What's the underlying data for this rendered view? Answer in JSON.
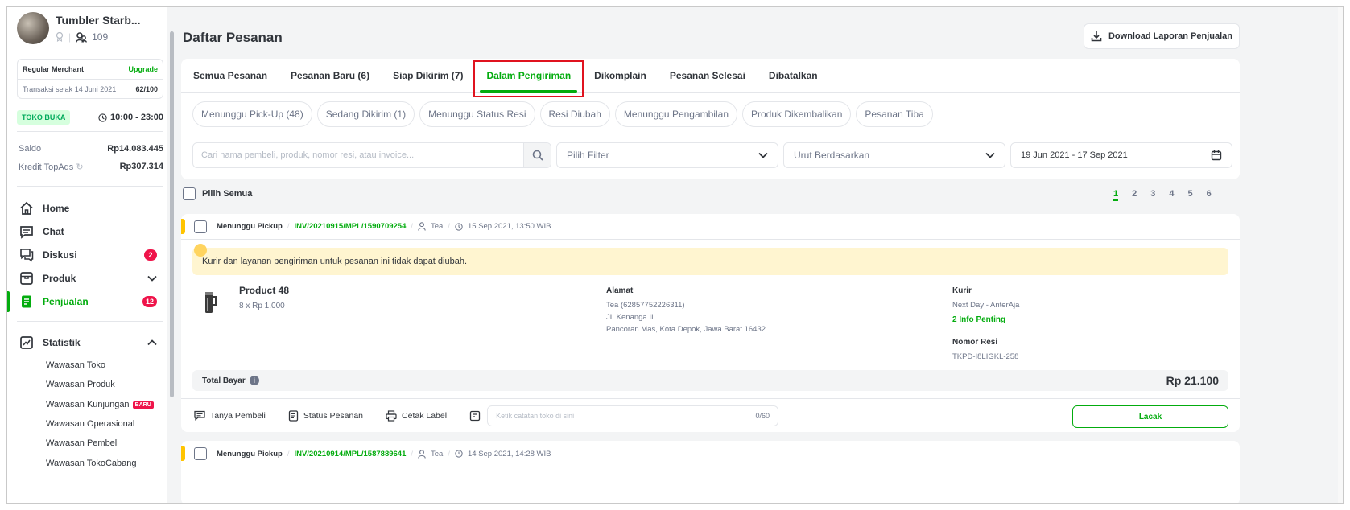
{
  "profile": {
    "shop_name": "Tumbler Starb...",
    "followers": "109"
  },
  "merchant": {
    "tier": "Regular Merchant",
    "upgrade": "Upgrade",
    "since": "Transaksi sejak 14 Juni 2021",
    "score": "62/100"
  },
  "store_status": {
    "badge": "TOKO BUKA",
    "hours": "10:00 - 23:00"
  },
  "balance": {
    "saldo_label": "Saldo",
    "saldo_value": "Rp14.083.445",
    "kredit_label": "Kredit TopAds",
    "kredit_value": "Rp307.314"
  },
  "nav": {
    "home": "Home",
    "chat": "Chat",
    "diskusi": "Diskusi",
    "diskusi_count": "2",
    "produk": "Produk",
    "penjualan": "Penjualan",
    "penjualan_count": "12",
    "statistik": "Statistik"
  },
  "statistik_items": [
    "Wawasan Toko",
    "Wawasan Produk",
    "Wawasan Kunjungan",
    "Wawasan Operasional",
    "Wawasan Pembeli",
    "Wawasan TokoCabang"
  ],
  "new_badge": "BARU",
  "page": {
    "title": "Daftar Pesanan",
    "download_label": "Download Laporan Penjualan"
  },
  "tabs": [
    "Semua Pesanan",
    "Pesanan Baru (6)",
    "Siap Dikirim (7)",
    "Dalam Pengiriman",
    "Dikomplain",
    "Pesanan Selesai",
    "Dibatalkan"
  ],
  "chips": [
    "Menunggu Pick-Up (48)",
    "Sedang Dikirim (1)",
    "Menunggu Status Resi",
    "Resi Diubah",
    "Menunggu Pengambilan",
    "Produk Dikembalikan",
    "Pesanan Tiba"
  ],
  "filters": {
    "search_placeholder": "Cari nama pembeli, produk, nomor resi, atau invoice...",
    "filter_label": "Pilih Filter",
    "sort_label": "Urut Berdasarkan",
    "date_range": "19 Jun 2021 - 17 Sep 2021"
  },
  "select_all": "Pilih Semua",
  "pages": [
    "1",
    "2",
    "3",
    "4",
    "5",
    "6"
  ],
  "orders": [
    {
      "status": "Menunggu Pickup",
      "invoice": "INV/20210915/MPL/1590709254",
      "buyer": "Tea",
      "datetime": "15 Sep 2021, 13:50 WIB",
      "warning": "Kurir dan layanan pengiriman untuk pesanan ini tidak dapat diubah.",
      "product_name": "Product 48",
      "product_qty": "8 x Rp 1.000",
      "address_label": "Alamat",
      "address_name": "Tea (62857752226311)",
      "address_line1": "JL.Kenanga II",
      "address_line2": "Pancoran Mas, Kota Depok, Jawa Barat 16432",
      "courier_label": "Kurir",
      "courier_value": "Next Day - AnterAja",
      "courier_info": "2 Info Penting",
      "resi_label": "Nomor Resi",
      "resi_value": "TKPD-I8LIGKL-258",
      "total_label": "Total Bayar",
      "total_value": "Rp 21.100",
      "actions": {
        "ask": "Tanya Pembeli",
        "status": "Status Pesanan",
        "print": "Cetak Label"
      },
      "note_placeholder": "Ketik catatan toko di sini",
      "note_count": "0/60",
      "track": "Lacak"
    },
    {
      "status": "Menunggu Pickup",
      "invoice": "INV/20210914/MPL/1587889641",
      "buyer": "Tea",
      "datetime": "14 Sep 2021, 14:28 WIB"
    }
  ],
  "colors": {
    "accent": "#03ac0e",
    "alert": "#ef144a",
    "highlight": "#e0131f",
    "warning_bg": "#fff5d0"
  }
}
